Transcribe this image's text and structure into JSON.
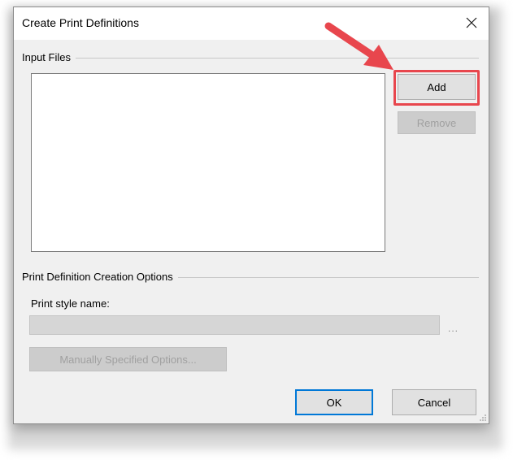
{
  "window": {
    "title": "Create Print Definitions",
    "close_label": "×"
  },
  "input_files": {
    "group_label": "Input Files",
    "items": [],
    "add_label": "Add",
    "remove_label": "Remove"
  },
  "options": {
    "group_label": "Print Definition Creation Options",
    "style_name_label": "Print style name:",
    "style_name_value": "",
    "browse_label": "...",
    "manual_options_label": "Manually Specified Options..."
  },
  "footer": {
    "ok_label": "OK",
    "cancel_label": "Cancel"
  },
  "colors": {
    "annotation": "#e8464d",
    "default_button_border": "#0078d7"
  }
}
